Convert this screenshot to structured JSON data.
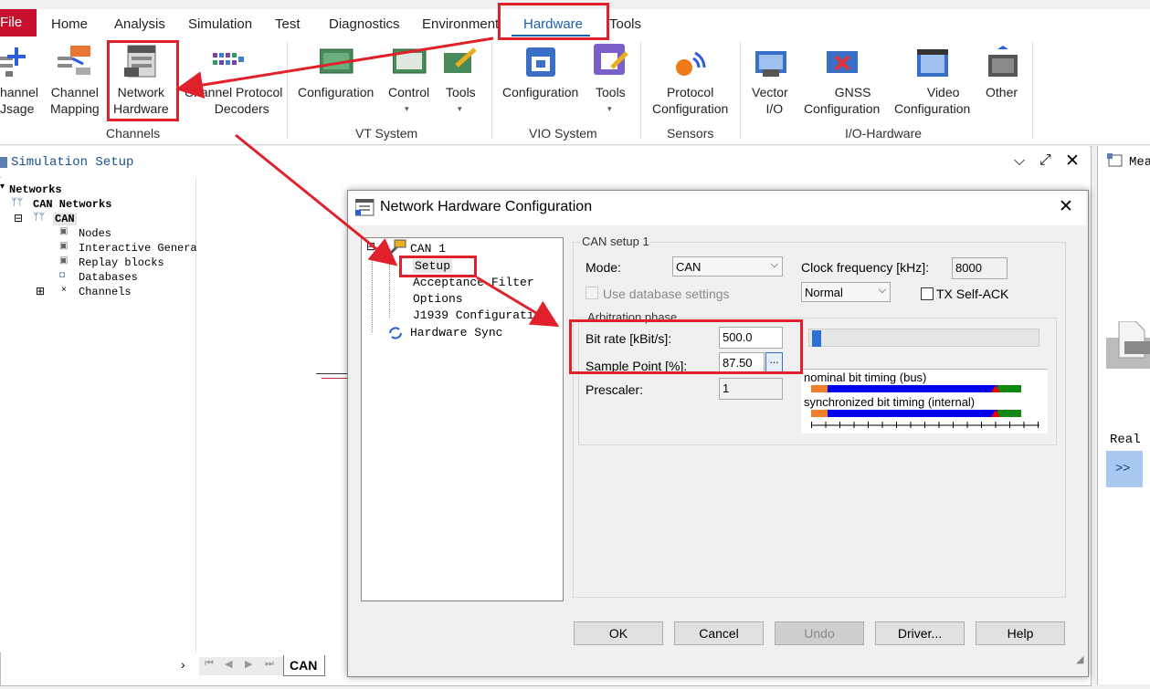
{
  "menu": {
    "file": "File",
    "items": [
      "Home",
      "Analysis",
      "Simulation",
      "Test",
      "Diagnostics",
      "Environment",
      "Hardware",
      "Tools"
    ]
  },
  "ribbon": {
    "channel_usage": [
      "hannel",
      "Jsage"
    ],
    "channel_mapping": [
      "Channel",
      "Mapping"
    ],
    "network_hardware": [
      "Network",
      "Hardware"
    ],
    "channel_protocol_decoders": [
      "Channel Protocol",
      "Decoders"
    ],
    "vt_configuration": "Configuration",
    "vt_control": "Control",
    "vt_tools": "Tools",
    "vio_configuration": "Configuration",
    "vio_tools": "Tools",
    "protocol_configuration": [
      "Protocol",
      "Configuration"
    ],
    "vector_io": [
      "Vector",
      "I/O"
    ],
    "gnss_configuration": [
      "GNSS",
      "Configuration"
    ],
    "video_configuration": [
      "Video",
      "Configuration"
    ],
    "other": "Other",
    "groups": {
      "channels": "Channels",
      "vt_system": "VT System",
      "vio_system": "VIO System",
      "sensors": "Sensors",
      "io_hardware": "I/O-Hardware"
    }
  },
  "sim_panel": {
    "title": "Simulation Setup",
    "tree": {
      "networks": "Networks",
      "can_networks": "CAN Networks",
      "can": "CAN",
      "nodes": "Nodes",
      "interactive_generator": "Interactive Genera",
      "replay_blocks": "Replay blocks",
      "databases": "Databases",
      "channels": "Channels"
    },
    "tab_can": "CAN"
  },
  "right_panel": {
    "title": "Mea",
    "real": "Real",
    "arrow": ">>"
  },
  "dialog": {
    "title": "Network Hardware Configuration",
    "tree": {
      "can1": "CAN 1",
      "setup": "Setup",
      "acceptance_filter": "Acceptance Filter",
      "options": "Options",
      "j1939": "J1939 Configuration",
      "hardware_sync": "Hardware Sync"
    },
    "setup_group": "CAN setup 1",
    "mode_label": "Mode:",
    "mode_value": "CAN",
    "clock_label": "Clock frequency [kHz]:",
    "clock_value": "8000",
    "use_db_label": "Use database settings",
    "normal_value": "Normal",
    "tx_self_ack_label": "TX Self-ACK",
    "arbitration_group": "Arbitration phase",
    "bitrate_label": "Bit rate [kBit/s]:",
    "bitrate_value": "500.0",
    "sample_point_label": "Sample Point [%]:",
    "sample_point_value": "87.50",
    "ellipsis": "...",
    "prescaler_label": "Prescaler:",
    "prescaler_value": "1",
    "slider_level": 0.01,
    "nominal_label": "nominal bit timing (bus)",
    "sync_label": "synchronized bit timing (internal)",
    "buttons": {
      "ok": "OK",
      "cancel": "Cancel",
      "undo": "Undo",
      "driver": "Driver...",
      "help": "Help"
    }
  },
  "colors": {
    "file_tab": "#c8102e",
    "hardware_tab": "#1a5fb4",
    "annotation": "#e0202a",
    "timing_orange": "#f08030",
    "timing_blue": "#0000ee",
    "timing_green": "#118811",
    "timing_marker": "#ee0000"
  }
}
